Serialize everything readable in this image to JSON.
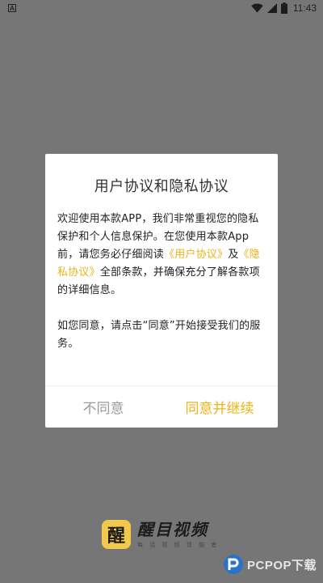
{
  "status_bar": {
    "time": "11:43",
    "left_icon": "notification-a-icon",
    "icons": [
      "wifi-icon",
      "cell-signal-icon",
      "battery-icon"
    ]
  },
  "dialog": {
    "title": "用户协议和隐私协议",
    "para1_a": "欢迎使用本款APP，我们非常重视您的隐私保护和个人信息保护。在您使用本款App前，请您务必仔细阅读",
    "link_user_agreement": "《用户协议》",
    "para1_b": "及",
    "link_privacy_agreement": "《隐私协议》",
    "para1_c": "全部条款，并确保充分了解各款项的详细信息。",
    "para2": "如您同意，请点击“同意”开始接受我们的服务。",
    "disagree_label": "不同意",
    "agree_label": "同意并继续"
  },
  "brand": {
    "logo_char": "醒",
    "name": "醒目视频",
    "slogan": "每 话 视 频 现 脑 者"
  },
  "watermark": {
    "text": "PCPOP下载"
  },
  "colors": {
    "overlay": "#767676",
    "accent": "#e9b416",
    "logo_bg": "#f2c94c"
  }
}
